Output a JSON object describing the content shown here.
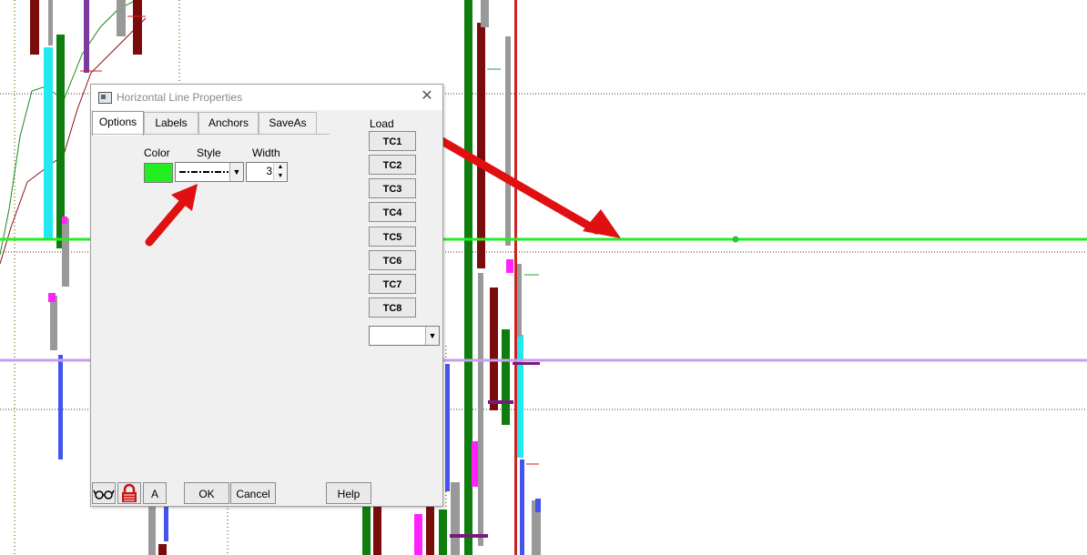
{
  "dialog": {
    "title": "Horizontal Line Properties",
    "tabs": [
      {
        "label": "Options"
      },
      {
        "label": "Labels"
      },
      {
        "label": "Anchors"
      },
      {
        "label": "SaveAs"
      }
    ],
    "labels": {
      "color": "Color",
      "style": "Style",
      "width": "Width",
      "load": "Load"
    },
    "color_value": "#22ee22",
    "width_value": "3",
    "tc_buttons": [
      "TC1",
      "TC2",
      "TC3",
      "TC4",
      "TC5",
      "TC6",
      "TC7",
      "TC8"
    ],
    "bottom": {
      "a_label": "A",
      "ok": "OK",
      "cancel": "Cancel",
      "help": "Help"
    }
  },
  "colors": {
    "accent_line": "#22ee22",
    "purple_line": "#c79ef0",
    "arrow": "#e01010",
    "bar_green": "#0e7d0e",
    "bar_dark_red": "#7b0c0c",
    "bar_cyan": "#22e8f0",
    "bar_magenta": "#ff22ff",
    "bar_gray": "#999999",
    "bar_purple": "#7a1a7a",
    "bar_blue": "#4455ee"
  }
}
